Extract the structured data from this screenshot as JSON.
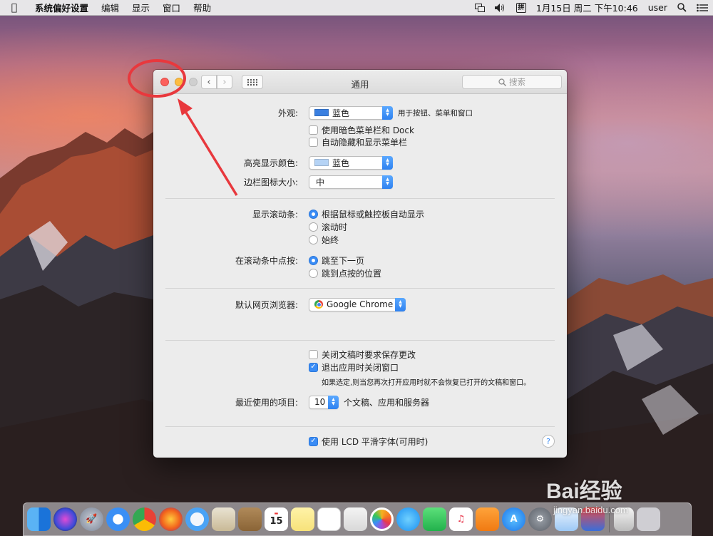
{
  "menubar": {
    "app_name": "系统偏好设置",
    "items": [
      "编辑",
      "显示",
      "窗口",
      "帮助"
    ],
    "ime_label": "拼",
    "datetime": "1月15日 周二 下午10:46",
    "user": "user"
  },
  "window": {
    "title": "通用",
    "search_placeholder": "搜索"
  },
  "appearance": {
    "label": "外观:",
    "value": "蓝色",
    "swatch_color": "#3a7fe0",
    "note": "用于按钮、菜单和窗口",
    "dark_menu_label": "使用暗色菜单栏和 Dock",
    "dark_menu_checked": false,
    "autohide_label": "自动隐藏和显示菜单栏",
    "autohide_checked": false
  },
  "highlight": {
    "label": "高亮显示颜色:",
    "value": "蓝色",
    "swatch_color": "#b5d3f5"
  },
  "sidebar_icon_size": {
    "label": "边栏图标大小:",
    "value": "中"
  },
  "scrollbars": {
    "label": "显示滚动条:",
    "options": [
      "根据鼠标或触控板自动显示",
      "滚动时",
      "始终"
    ],
    "selected_index": 0
  },
  "scroll_click": {
    "label": "在滚动条中点按:",
    "options": [
      "跳至下一页",
      "跳到点按的位置"
    ],
    "selected_index": 0
  },
  "browser": {
    "label": "默认网页浏览器:",
    "value": "Google Chrome"
  },
  "documents": {
    "ask_save_label": "关闭文稿时要求保存更改",
    "ask_save_checked": false,
    "close_windows_label": "退出应用时关闭窗口",
    "close_windows_checked": true,
    "close_windows_note": "如果选定,则当您再次打开应用时就不会恢复已打开的文稿和窗口。"
  },
  "recent_items": {
    "label": "最近使用的项目:",
    "value": "10",
    "suffix": "个文稿、应用和服务器"
  },
  "lcd": {
    "label": "使用 LCD 平滑字体(可用时)",
    "checked": true
  },
  "help_label": "?",
  "dock": {
    "calendar_day": "15"
  },
  "watermark": {
    "text": "Bai经验",
    "sub": "jingyan.baidu.com"
  },
  "colors": {
    "accent": "#3a8cf5",
    "close": "#fc605c",
    "minimize": "#fdbc40",
    "annotation": "#e8383d"
  }
}
